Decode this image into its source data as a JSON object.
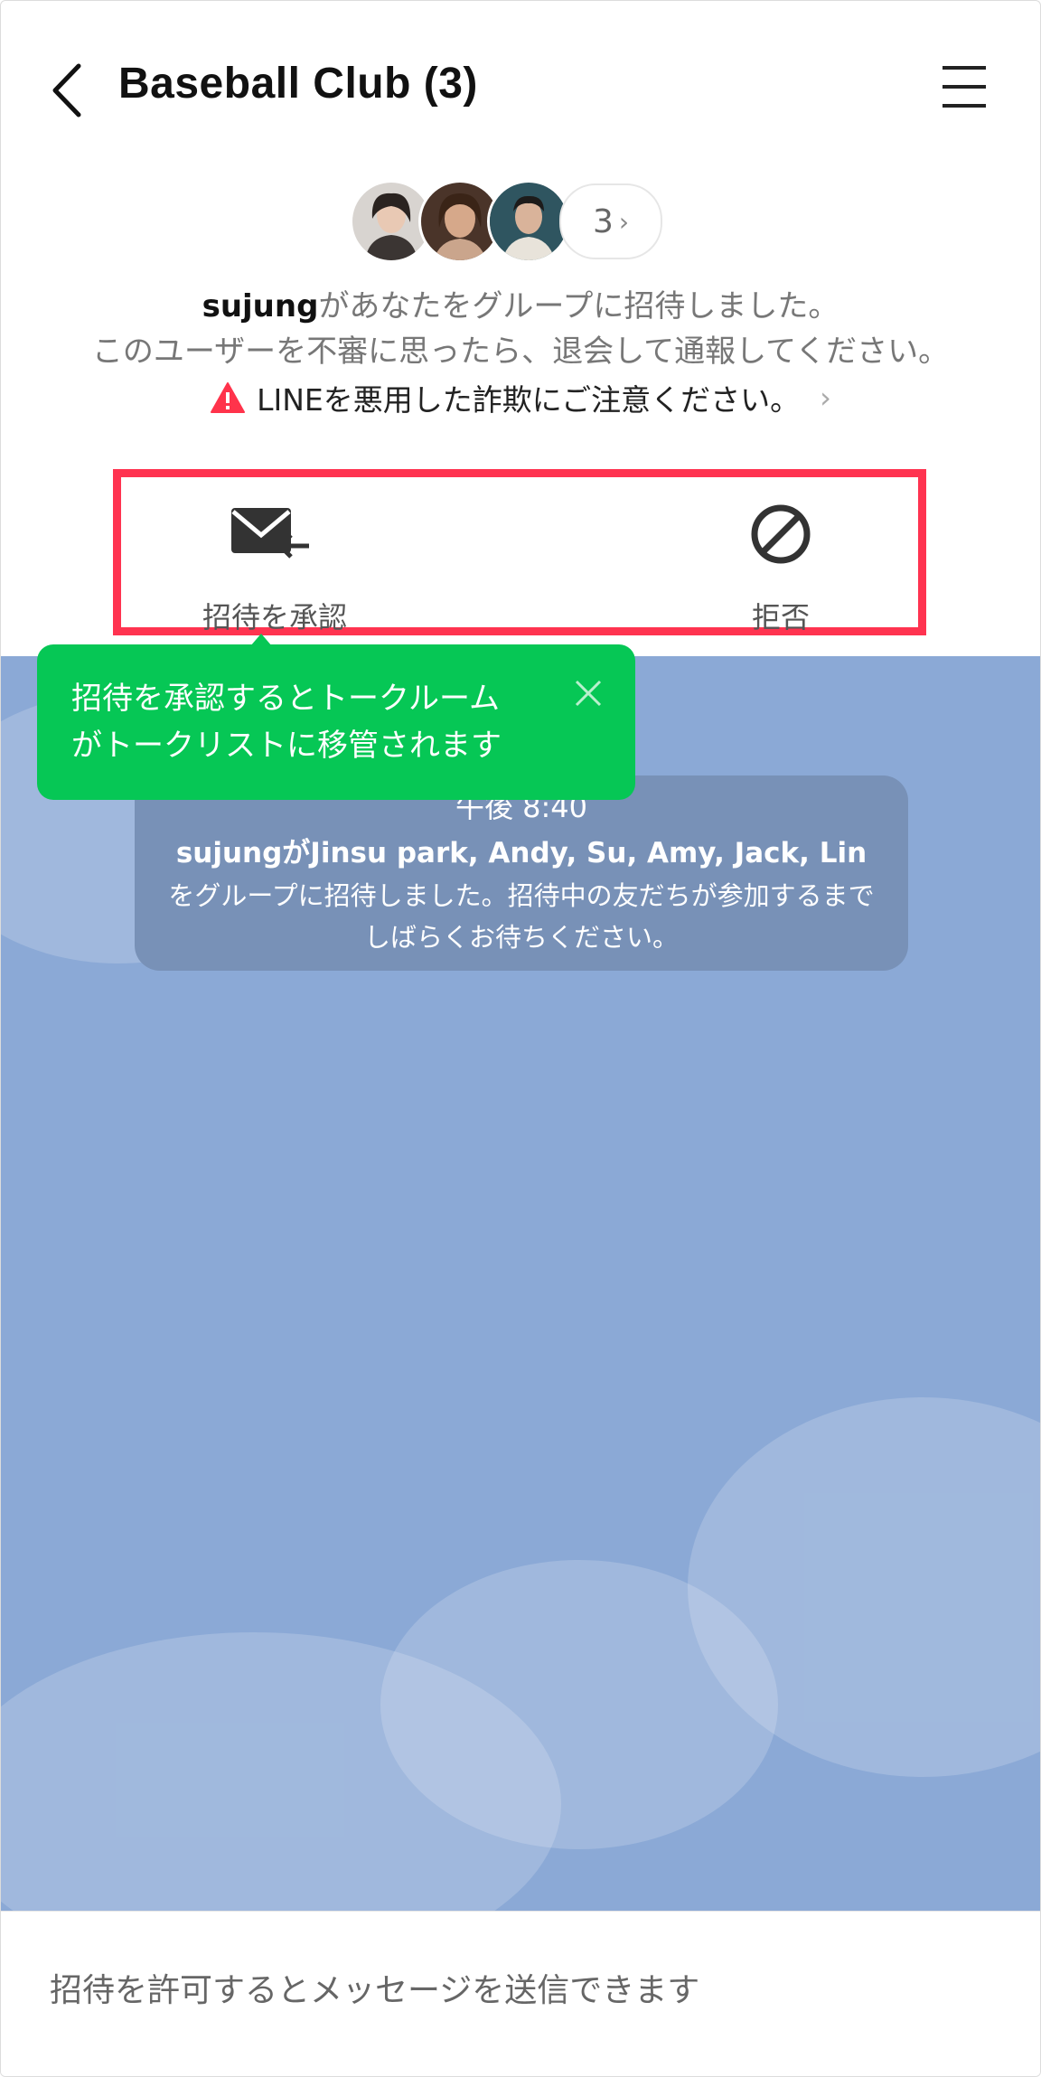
{
  "header": {
    "title": "Baseball Club (3)"
  },
  "group": {
    "member_count": "3",
    "inviter": "sujung",
    "invite_text": "があなたをグループに招待しました。",
    "advice_text": "このユーザーを不審に思ったら、退会して通報してください。",
    "warning_text": "LINEを悪用した詐欺にご注意ください。"
  },
  "actions": {
    "accept_label": "招待を承認",
    "reject_label": "拒否"
  },
  "tooltip": {
    "line1": "招待を承認するとトークルーム",
    "line2": "がトークリストに移管されます"
  },
  "system_message": {
    "time": "午後 8:40",
    "line1": "sujungがJinsu park, Andy, Su, Amy, Jack, Lin",
    "line2": "をグループに招待しました。招待中の友だちが参加するまで",
    "line3": "しばらくお待ちください。"
  },
  "footer": {
    "message": "招待を許可するとメッセージを送信できます"
  },
  "colors": {
    "brand_green": "#06c755",
    "highlight_red": "#ff3350",
    "chat_background": "#8ba9d6",
    "warning_red": "#ff334b"
  }
}
